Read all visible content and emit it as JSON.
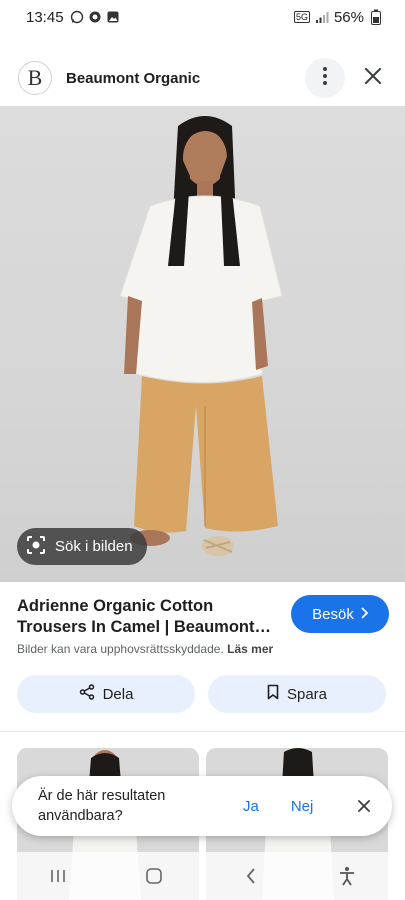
{
  "status": {
    "time": "13:45",
    "network": "5G",
    "battery": "56%"
  },
  "header": {
    "logo_letter": "B",
    "site_name": "Beaumont Organic"
  },
  "image": {
    "lens_label": "Sök i bilden"
  },
  "result": {
    "title": "Adrienne Organic Cotton Trousers In Camel | Beaumont…",
    "visit_label": "Besök",
    "copyright_text": "Bilder kan vara upphovsrättsskyddade.",
    "learn_more": "Läs mer"
  },
  "actions": {
    "share_label": "Dela",
    "save_label": "Spara"
  },
  "feedback": {
    "question": "Är de här resultaten användbara?",
    "yes": "Ja",
    "no": "Nej"
  },
  "colors": {
    "accent": "#1a73e8",
    "chip_bg": "#e8f0fe",
    "trousers": "#d9a565"
  },
  "icons": [
    "whatsapp-icon",
    "notification-icon",
    "gallery-icon",
    "signal-icon",
    "battery-icon",
    "more-vert-icon",
    "close-icon",
    "lens-icon",
    "chevron-right-icon",
    "share-icon",
    "bookmark-icon",
    "recent-apps-icon",
    "home-icon",
    "back-icon",
    "accessibility-icon"
  ]
}
